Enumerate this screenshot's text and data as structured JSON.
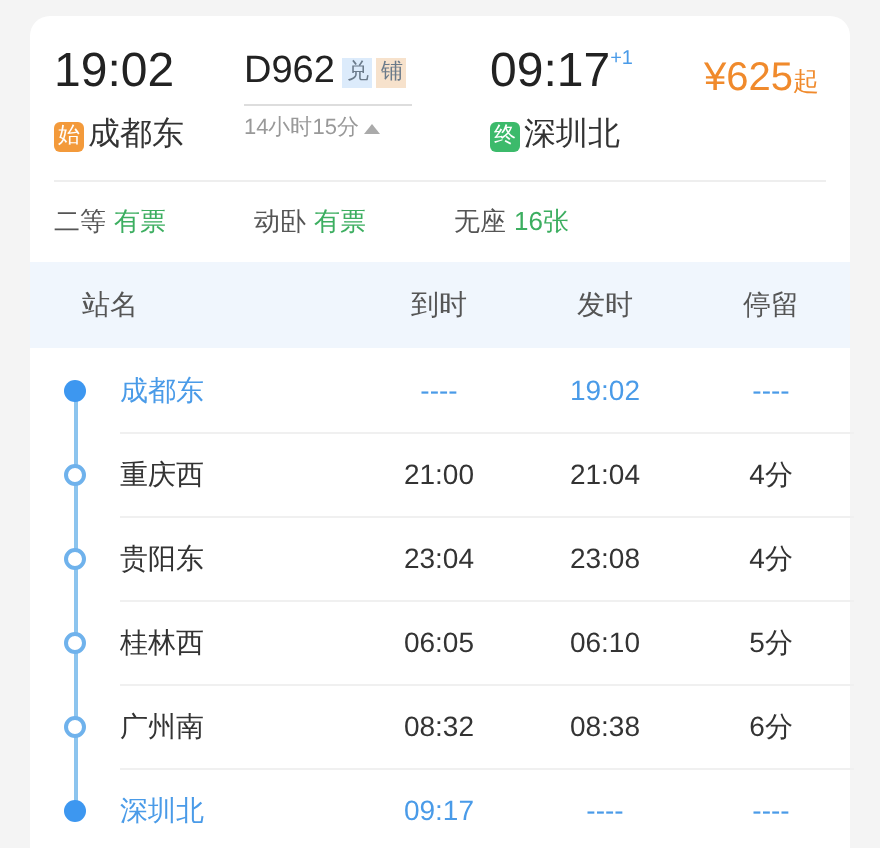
{
  "departure": {
    "time": "19:02",
    "station": "成都东",
    "tag": "始"
  },
  "train": {
    "number": "D962",
    "badges": [
      {
        "text": "兑",
        "color": "#dcebfb"
      },
      {
        "text": "铺",
        "color": "#f7e2cc"
      }
    ],
    "duration": "14小时15分",
    "expanded": true
  },
  "arrival": {
    "time": "09:17",
    "day_offset": "+1",
    "station": "深圳北",
    "tag": "终"
  },
  "price": {
    "amount": "¥625",
    "suffix": "起"
  },
  "seats": [
    {
      "class": "二等",
      "status": "有票"
    },
    {
      "class": "动卧",
      "status": "有票"
    },
    {
      "class": "无座",
      "status": "16张"
    }
  ],
  "table": {
    "columns": [
      "站名",
      "到时",
      "发时",
      "停留"
    ],
    "rows": [
      {
        "kind": "terminal",
        "station": "成都东",
        "arrive": "----",
        "depart": "19:02",
        "stop": "----"
      },
      {
        "kind": "intermediate",
        "station": "重庆西",
        "arrive": "21:00",
        "depart": "21:04",
        "stop": "4分"
      },
      {
        "kind": "intermediate",
        "station": "贵阳东",
        "arrive": "23:04",
        "depart": "23:08",
        "stop": "4分"
      },
      {
        "kind": "intermediate",
        "station": "桂林西",
        "arrive": "06:05",
        "depart": "06:10",
        "stop": "5分"
      },
      {
        "kind": "intermediate",
        "station": "广州南",
        "arrive": "08:32",
        "depart": "08:38",
        "stop": "6分"
      },
      {
        "kind": "terminal",
        "station": "深圳北",
        "arrive": "09:17",
        "depart": "----",
        "stop": "----"
      }
    ]
  }
}
